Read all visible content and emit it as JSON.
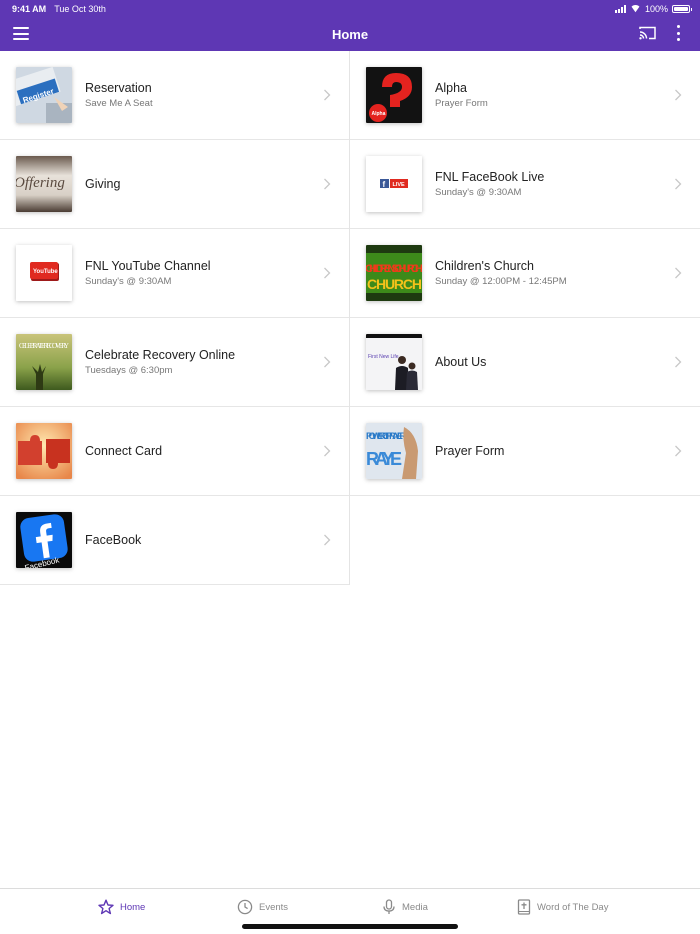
{
  "status": {
    "time": "9:41 AM",
    "date": "Tue Oct 30th",
    "battery": "100%"
  },
  "appbar": {
    "title": "Home"
  },
  "left_items": [
    {
      "title": "Reservation",
      "subtitle": "Save Me A Seat",
      "thumb_text": "Register"
    },
    {
      "title": "Giving",
      "subtitle": "",
      "thumb_text": "Offering"
    },
    {
      "title": "FNL YouTube Channel",
      "subtitle": "Sunday's @ 9:30AM",
      "thumb_text": "YouTube"
    },
    {
      "title": "Celebrate Recovery Online",
      "subtitle": "Tuesdays @ 6:30pm",
      "thumb_text": "CELEBRATE RECOVERY"
    },
    {
      "title": "Connect Card",
      "subtitle": ""
    },
    {
      "title": "FaceBook",
      "subtitle": "",
      "thumb_text": "Facebook"
    }
  ],
  "right_items": [
    {
      "title": "Alpha",
      "subtitle": "Prayer Form",
      "thumb_text": "Alpha"
    },
    {
      "title": "FNL FaceBook Live",
      "subtitle": "Sunday's @ 9:30AM",
      "thumb_text": "LIVE"
    },
    {
      "title": "Children's Church",
      "subtitle": "Sunday @ 12:00PM - 12:45PM",
      "thumb_text": "CHILDRENS CHURCH"
    },
    {
      "title": "About Us",
      "subtitle": "",
      "thumb_text": "First New Life"
    },
    {
      "title": "Prayer Form",
      "subtitle": "",
      "thumb_text": "POWER OF PRAYER"
    }
  ],
  "tabs": [
    {
      "label": "Home",
      "icon": "star-icon",
      "active": true
    },
    {
      "label": "Events",
      "icon": "clock-icon",
      "active": false
    },
    {
      "label": "Media",
      "icon": "microphone-icon",
      "active": false
    },
    {
      "label": "Word of The Day",
      "icon": "bible-icon",
      "active": false
    }
  ],
  "colors": {
    "brand": "#5e37b4",
    "divider": "#e6e6e6",
    "muted": "#8a8a8a"
  }
}
